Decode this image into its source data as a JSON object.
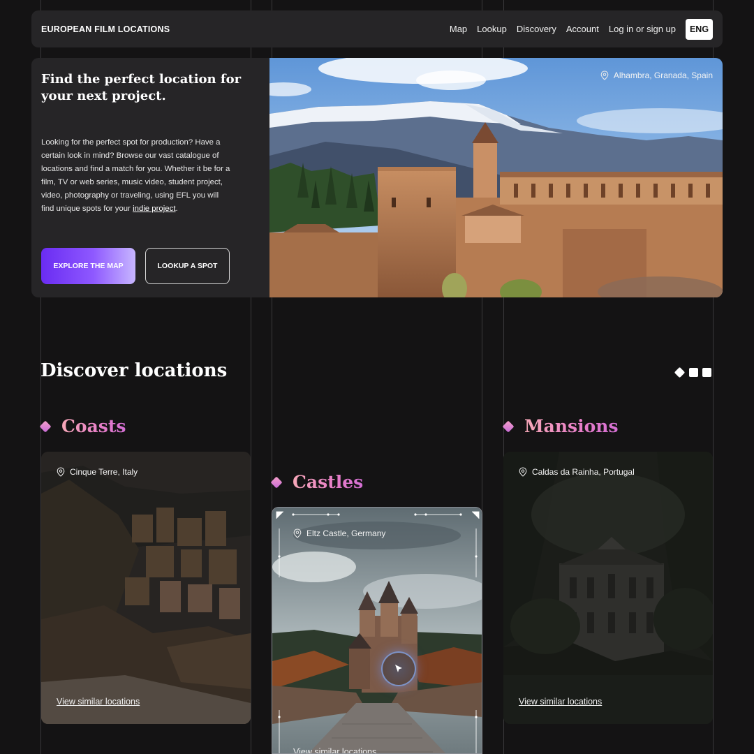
{
  "nav": {
    "brand": "EUROPEAN FILM LOCATIONS",
    "links": [
      "Map",
      "Lookup",
      "Discovery",
      "Account",
      "Log in or sign up"
    ],
    "language": "ENG"
  },
  "hero": {
    "title": "Find the perfect location for your next project.",
    "description": "Looking for the perfect spot for production? Have a certain look in mind? Browse our vast catalogue of locations and find a match for you. Whether it be for a film, TV or web series, music video, student project, video, photography or traveling, using EFL you will find unique spots for your ",
    "description_link": "indie project",
    "description_end": ".",
    "primary_button": "EXPLORE THE MAP",
    "secondary_button": "LOOKUP A SPOT",
    "image_location": "Alhambra, Granada, Spain"
  },
  "discover": {
    "title": "Discover locations",
    "pager": {
      "total": 3,
      "active": 0
    },
    "categories": [
      {
        "label": "Coasts",
        "location": "Cinque Terre, Italy",
        "link": "View similar locations"
      },
      {
        "label": "Castles",
        "location": "Eltz Castle, Germany",
        "link": "View similar locations"
      },
      {
        "label": "Mansions",
        "location": "Caldas da Rainha, Portugal",
        "link": "View similar locations"
      }
    ]
  },
  "colors": {
    "background": "#141314",
    "panel": "#262527",
    "accent_purple": "#6a2cf2",
    "accent_pink": "#e77ec8"
  }
}
